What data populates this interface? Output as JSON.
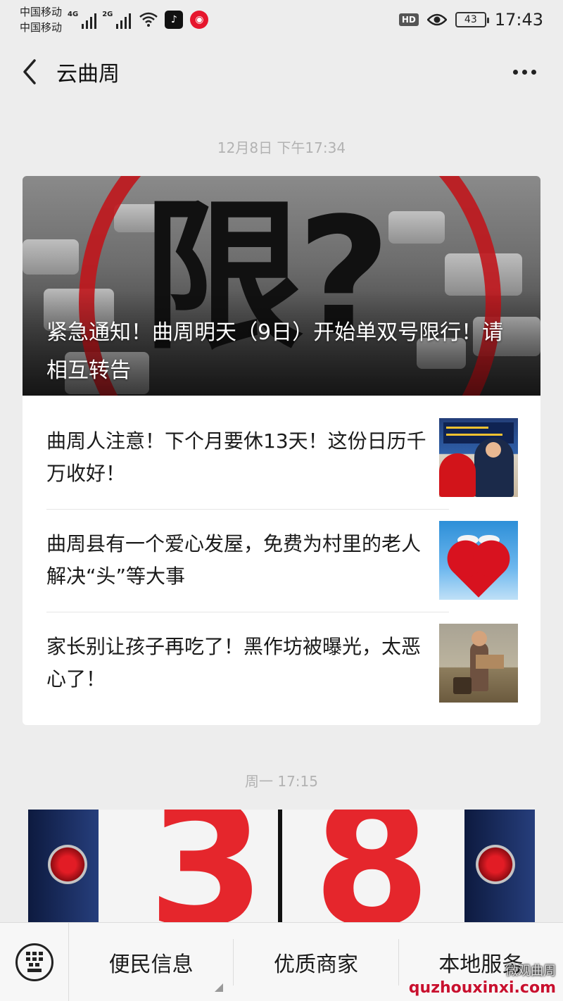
{
  "status_bar": {
    "carrier_1": "中国移动",
    "carrier_2": "中国移动",
    "network_1": "4G",
    "network_2": "2G",
    "hd": "HD",
    "battery": "43",
    "time": "17:43",
    "icons": [
      "signal-icon",
      "wifi-icon",
      "tiktok-icon",
      "weibo-icon",
      "eye-icon",
      "battery-icon"
    ]
  },
  "nav": {
    "title": "云曲周",
    "back_icon": "back-arrow-icon",
    "more_icon": "more-dots-icon"
  },
  "messages": [
    {
      "timestamp": "12月8日 下午17:34",
      "cover": {
        "overlay_text": "限?",
        "title": "紧急通知！曲周明天（9日）开始单双号限行！请相互转告"
      },
      "articles": [
        {
          "title": "曲周人注意！下个月要休13天！这份日历千万收好！"
        },
        {
          "title": "曲周县有一个爱心发屋，免费为村里的老人解决“头”等大事"
        },
        {
          "title": "家长别让孩子再吃了！黑作坊被曝光，太恶心了！"
        }
      ]
    },
    {
      "timestamp": "周一 17:15",
      "cover": {
        "overlay_text_1": "3",
        "overlay_text_2": "8"
      }
    }
  ],
  "bottom_menu": {
    "keyboard_icon": "keyboard-icon",
    "items": [
      {
        "label": "便民信息"
      },
      {
        "label": "优质商家"
      },
      {
        "label": "本地服务"
      }
    ]
  },
  "watermark": {
    "top": "微观曲周",
    "site": "quzhouxinxi.com"
  },
  "colors": {
    "background": "#ededed",
    "accent_red": "#c0161c",
    "timestamp_gray": "#b2b2b2"
  }
}
